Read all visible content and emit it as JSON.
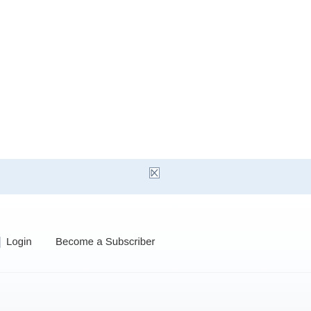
{
  "banner": {
    "image_icon": "broken-image-icon"
  },
  "nav": {
    "login_label": "Login",
    "subscribe_label": "Become a Subscriber"
  },
  "colors": {
    "banner_background": "#e3eef8",
    "link_text": "#333333"
  }
}
